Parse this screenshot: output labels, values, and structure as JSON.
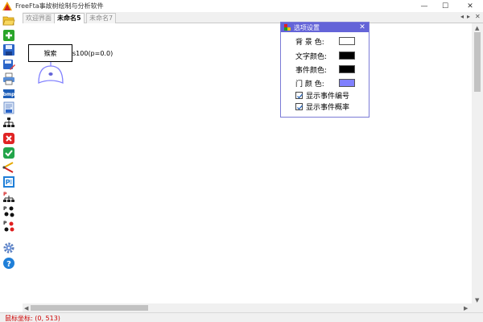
{
  "window": {
    "title": "FreeFta事故树绘制与分析软件",
    "minimize": "—",
    "maximize": "☐",
    "close": "✕"
  },
  "tabs": [
    {
      "label": "欢迎界面",
      "active": false
    },
    {
      "label": "未命名5",
      "active": true
    },
    {
      "label": "未命名7",
      "active": false
    }
  ],
  "tab_nav": {
    "prev": "◂",
    "next": "▸",
    "close": "✕"
  },
  "toolbar": [
    "open-folder-icon",
    "add-icon",
    "save-icon",
    "save-as-icon",
    "print-icon",
    "export-bmp-icon",
    "export-text-icon",
    "tree-layout-icon",
    "delete-icon",
    "check-icon",
    "link-icon",
    "report-icon",
    "probability-tree-icon",
    "probability-dots-icon",
    "probability-red-icon",
    "settings-icon",
    "help-icon"
  ],
  "diagram": {
    "event_label": "猴索",
    "event_annotation": "s100(p=0.0)"
  },
  "options_panel": {
    "title": "选项设置",
    "close": "✕",
    "background_label": "背 景 色:",
    "text_color_label": "文字颜色:",
    "event_color_label": "事件颜色:",
    "gate_color_label": "门 颜 色:",
    "colors": {
      "background": "#ffffff",
      "text": "#000000",
      "event": "#000000",
      "gate": "#8080ff"
    },
    "show_event_number": {
      "label": "显示事件编号",
      "checked": true
    },
    "show_event_probability": {
      "label": "显示事件概率",
      "checked": true
    }
  },
  "status": {
    "mouse_coords": "鼠标坐标:  (0, 513)"
  }
}
